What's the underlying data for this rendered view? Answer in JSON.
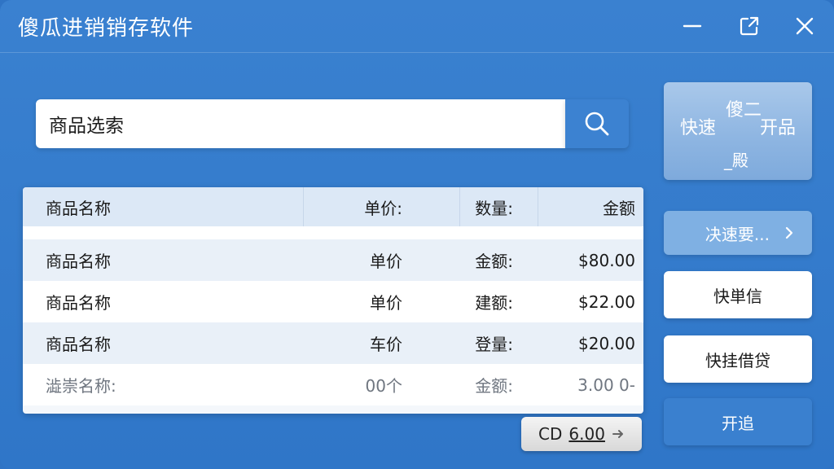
{
  "window": {
    "title": "傻瓜进销销存软件"
  },
  "search": {
    "value": "商品选索"
  },
  "table": {
    "header": {
      "name": "商品名称",
      "price": "单价:",
      "qty": "数量:",
      "amount": "金额"
    },
    "rows": [
      {
        "name": "商品名称",
        "price": "单价",
        "qty": "金额:",
        "amount": "$80.00"
      },
      {
        "name": "商品名称",
        "price": "单价",
        "qty": "建额:",
        "amount": "$22.00"
      },
      {
        "name": "商品名称",
        "price": "车价",
        "qty": "登量:",
        "amount": "$20.00"
      },
      {
        "name": "澁崇名称:",
        "price": "00个",
        "qty": "金额:",
        "amount": "3.00 0-"
      }
    ]
  },
  "total": {
    "label": "CD",
    "value": "6.00"
  },
  "sidebar": {
    "quick_panel": {
      "a": "快速",
      "b": "傻二",
      "c": "开品",
      "d": "_殿"
    },
    "menu": {
      "label": "决速要..."
    },
    "btn1": "快単信",
    "btn2": "快挂借贷",
    "btn3": "开追"
  },
  "colors": {
    "window_bg": "#2f76c8",
    "accent": "#3a80cf",
    "header_row": "#dce8f6",
    "alt_row": "#e9f0f8"
  },
  "icons": {
    "search": "search-icon",
    "minimize": "minimize-icon",
    "popout": "popout-icon",
    "close": "close-icon",
    "menu_chevron": "chevron-right-icon",
    "total_arrow": "arrow-right-icon"
  }
}
